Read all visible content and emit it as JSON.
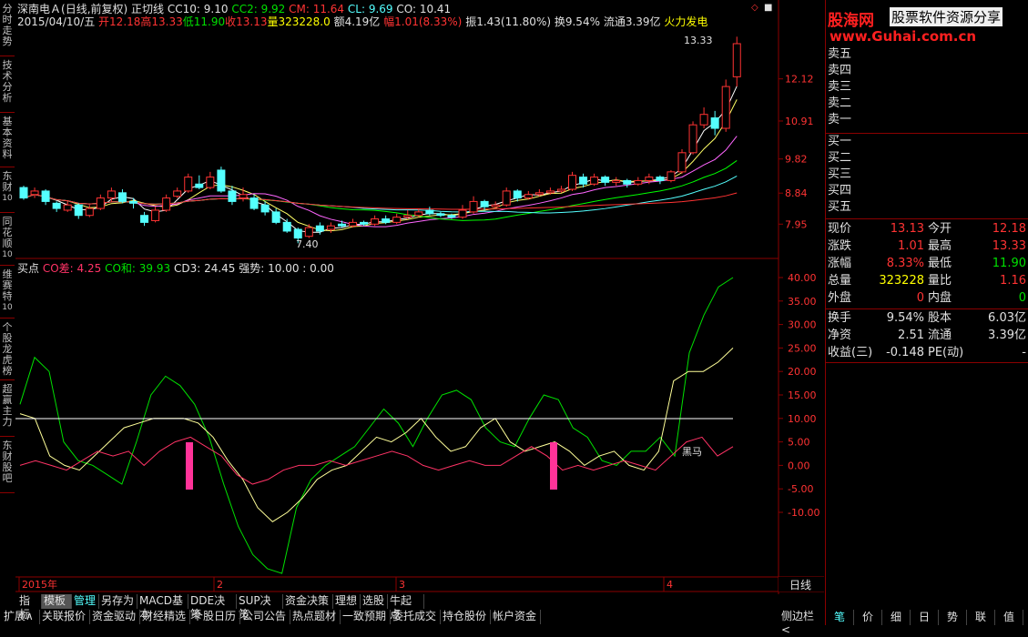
{
  "left_tabs": [
    {
      "label": "分时走势",
      "num": ""
    },
    {
      "label": "技术分析",
      "num": ""
    },
    {
      "label": "基本资料",
      "num": ""
    },
    {
      "label": "东财",
      "num": "10"
    },
    {
      "label": "同花顺",
      "num": "10"
    },
    {
      "label": "维赛特",
      "num": "10"
    },
    {
      "label": "个股龙虎榜",
      "num": ""
    },
    {
      "label": "超赢主力",
      "num": ""
    },
    {
      "label": "东财股吧",
      "num": ""
    }
  ],
  "header": {
    "stock": "深南电Ａ",
    "mode": "(日线,前复权)",
    "indicator": "正切线",
    "cc10": "CC10: 9.10",
    "cc2": "CC2: 9.92",
    "cm": "CM: 11.64",
    "cl": "CL: 9.69",
    "co": "CO: 10.41"
  },
  "infoline": {
    "date": "2015/04/10/五",
    "open": "开12.18",
    "high": "高13.33",
    "low": "低11.90",
    "close": "收13.13",
    "vol": "量323228.0",
    "amt": "额4.19亿",
    "chg": "幅1.01(8.33%)",
    "amp": "振1.43(11.80%)",
    "turn": "换9.54%",
    "float": "流通3.39亿",
    "sector": "火力发电"
  },
  "main_axis": [
    "12.12",
    "10.91",
    "9.82",
    "8.84",
    "7.95"
  ],
  "max_label": "13.33",
  "min_label": "7.40",
  "sub_header": {
    "name": "买点",
    "d1": "CO差: 4.25",
    "d2": "CO和: 39.93",
    "d3": "CD3: 24.45",
    "d4": "强势: 10.00 : 0.00"
  },
  "sub_axis": [
    "40.00",
    "35.00",
    "30.00",
    "25.00",
    "20.00",
    "15.00",
    "10.00",
    "5.00",
    "0.00",
    "-5.00",
    "-10.00"
  ],
  "sub_label": "黑马",
  "time_axis": [
    "2015年",
    "2",
    "3",
    "4"
  ],
  "period": "日线",
  "bottom_tabs1": [
    "指标",
    "模板",
    "管理",
    "另存为",
    "MACD基本",
    "DDE决策",
    "SUP决策",
    "资金决策",
    "理想",
    "选股",
    "牛起点"
  ],
  "bottom_tabs2": [
    "扩展∧",
    "关联报价",
    "资金驱动",
    "财经精选",
    "个股日历",
    "公司公告",
    "热点题材",
    "一致预期",
    "委托成交",
    "持仓股份",
    "帐户资金"
  ],
  "right_nav": [
    "侧边栏<",
    "<>"
  ],
  "logo": {
    "brand": "股海网",
    "slogan": "股票软件资源分享",
    "url": "www.Guhai.com.cn"
  },
  "sells": [
    "卖五",
    "卖四",
    "卖三",
    "卖二",
    "卖一"
  ],
  "buys": [
    "买一",
    "买二",
    "买三",
    "买四",
    "买五"
  ],
  "quote": [
    {
      "l1": "现价",
      "v1": "13.13",
      "c1": "#ff3333",
      "l2": "今开",
      "v2": "12.18",
      "c2": "#ff3333"
    },
    {
      "l1": "涨跌",
      "v1": "1.01",
      "c1": "#ff3333",
      "l2": "最高",
      "v2": "13.33",
      "c2": "#ff3333"
    },
    {
      "l1": "涨幅",
      "v1": "8.33%",
      "c1": "#ff3333",
      "l2": "最低",
      "v2": "11.90",
      "c2": "#00e000"
    },
    {
      "l1": "总量",
      "v1": "323228",
      "c1": "#ffff00",
      "l2": "量比",
      "v2": "1.16",
      "c2": "#ff3333"
    },
    {
      "l1": "外盘",
      "v1": "0",
      "c1": "#ff3333",
      "l2": "内盘",
      "v2": "0",
      "c2": "#00e000"
    }
  ],
  "quote2": [
    {
      "l1": "换手",
      "v1": "9.54%",
      "l2": "股本",
      "v2": "6.03亿"
    },
    {
      "l1": "净资",
      "v1": "2.51",
      "l2": "流通",
      "v2": "3.39亿"
    },
    {
      "l1": "收益(三)",
      "v1": "-0.148",
      "l2": "PE(动)",
      "v2": "-"
    }
  ],
  "right_tabs": [
    "笔",
    "价",
    "细",
    "日",
    "势",
    "联",
    "值"
  ],
  "colors": {
    "up": "#ff3333",
    "down": "#54ffff",
    "frame": "#8b0000"
  },
  "chart_data": {
    "type": "candlestick",
    "candles": [
      [
        9.0,
        8.7,
        9.05,
        8.65
      ],
      [
        8.8,
        8.9,
        9.0,
        8.7
      ],
      [
        8.9,
        8.6,
        8.95,
        8.5
      ],
      [
        8.55,
        8.4,
        8.6,
        8.3
      ],
      [
        8.35,
        8.5,
        8.6,
        8.3
      ],
      [
        8.5,
        8.2,
        8.55,
        8.1
      ],
      [
        8.2,
        8.4,
        8.5,
        8.15
      ],
      [
        8.4,
        8.7,
        8.8,
        8.35
      ],
      [
        8.7,
        8.9,
        9.0,
        8.6
      ],
      [
        8.85,
        8.6,
        8.95,
        8.55
      ],
      [
        8.6,
        8.55,
        8.7,
        8.4
      ],
      [
        8.2,
        8.0,
        8.3,
        7.9
      ],
      [
        8.05,
        8.35,
        8.45,
        8.0
      ],
      [
        8.35,
        8.7,
        8.8,
        8.3
      ],
      [
        8.75,
        8.9,
        9.0,
        8.7
      ],
      [
        8.9,
        9.3,
        9.4,
        8.85
      ],
      [
        9.1,
        9.0,
        9.35,
        8.95
      ],
      [
        9.0,
        9.3,
        9.45,
        8.95
      ],
      [
        9.5,
        8.9,
        9.6,
        8.85
      ],
      [
        8.9,
        8.6,
        9.05,
        8.5
      ],
      [
        8.7,
        8.8,
        9.0,
        8.6
      ],
      [
        8.7,
        8.4,
        8.8,
        8.35
      ],
      [
        8.5,
        8.3,
        8.6,
        8.2
      ],
      [
        8.3,
        8.0,
        8.4,
        7.95
      ],
      [
        8.0,
        7.75,
        8.1,
        7.7
      ],
      [
        7.8,
        7.55,
        7.85,
        7.4
      ],
      [
        7.6,
        7.85,
        7.95,
        7.55
      ],
      [
        7.9,
        7.75,
        8.0,
        7.65
      ],
      [
        7.8,
        7.9,
        8.0,
        7.7
      ],
      [
        7.95,
        7.9,
        8.05,
        7.85
      ],
      [
        7.9,
        8.0,
        8.1,
        7.85
      ],
      [
        8.0,
        7.95,
        8.05,
        7.9
      ],
      [
        7.95,
        8.1,
        8.2,
        7.9
      ],
      [
        8.1,
        8.0,
        8.2,
        7.95
      ],
      [
        8.0,
        8.15,
        8.25,
        7.95
      ],
      [
        8.15,
        8.2,
        8.35,
        8.1
      ],
      [
        8.2,
        8.3,
        8.4,
        8.15
      ],
      [
        8.35,
        8.25,
        8.45,
        8.2
      ],
      [
        8.25,
        8.2,
        8.3,
        8.15
      ],
      [
        8.2,
        8.15,
        8.25,
        8.1
      ],
      [
        8.15,
        8.35,
        8.5,
        8.1
      ],
      [
        8.3,
        8.6,
        8.75,
        8.25
      ],
      [
        8.6,
        8.45,
        8.65,
        8.35
      ],
      [
        8.45,
        8.5,
        8.6,
        8.4
      ],
      [
        8.5,
        8.9,
        9.0,
        8.45
      ],
      [
        8.9,
        8.7,
        8.95,
        8.6
      ],
      [
        8.7,
        8.8,
        8.9,
        8.65
      ],
      [
        8.8,
        8.85,
        8.95,
        8.75
      ],
      [
        8.85,
        8.9,
        9.0,
        8.8
      ],
      [
        8.9,
        8.95,
        9.05,
        8.85
      ],
      [
        8.95,
        9.35,
        9.45,
        8.9
      ],
      [
        9.3,
        9.1,
        9.4,
        9.0
      ],
      [
        9.1,
        9.3,
        9.4,
        9.05
      ],
      [
        9.3,
        9.15,
        9.35,
        9.05
      ],
      [
        9.15,
        9.2,
        9.3,
        9.05
      ],
      [
        9.2,
        9.1,
        9.25,
        9.0
      ],
      [
        9.1,
        9.2,
        9.3,
        9.05
      ],
      [
        9.2,
        9.3,
        9.4,
        9.1
      ],
      [
        9.3,
        9.2,
        9.35,
        9.1
      ],
      [
        9.2,
        9.45,
        9.5,
        9.15
      ],
      [
        9.45,
        10.0,
        10.1,
        9.4
      ],
      [
        10.0,
        10.8,
        10.9,
        9.95
      ],
      [
        10.8,
        11.1,
        11.3,
        10.7
      ],
      [
        11.0,
        10.7,
        11.2,
        10.5
      ],
      [
        10.7,
        11.9,
        12.1,
        10.6
      ],
      [
        12.18,
        13.13,
        13.33,
        11.9
      ]
    ],
    "sub_series": [
      {
        "name": "CO差",
        "color": "#ff3366"
      },
      {
        "name": "CO和",
        "color": "#00e000"
      },
      {
        "name": "CD3",
        "color": "#ffff99"
      }
    ]
  }
}
